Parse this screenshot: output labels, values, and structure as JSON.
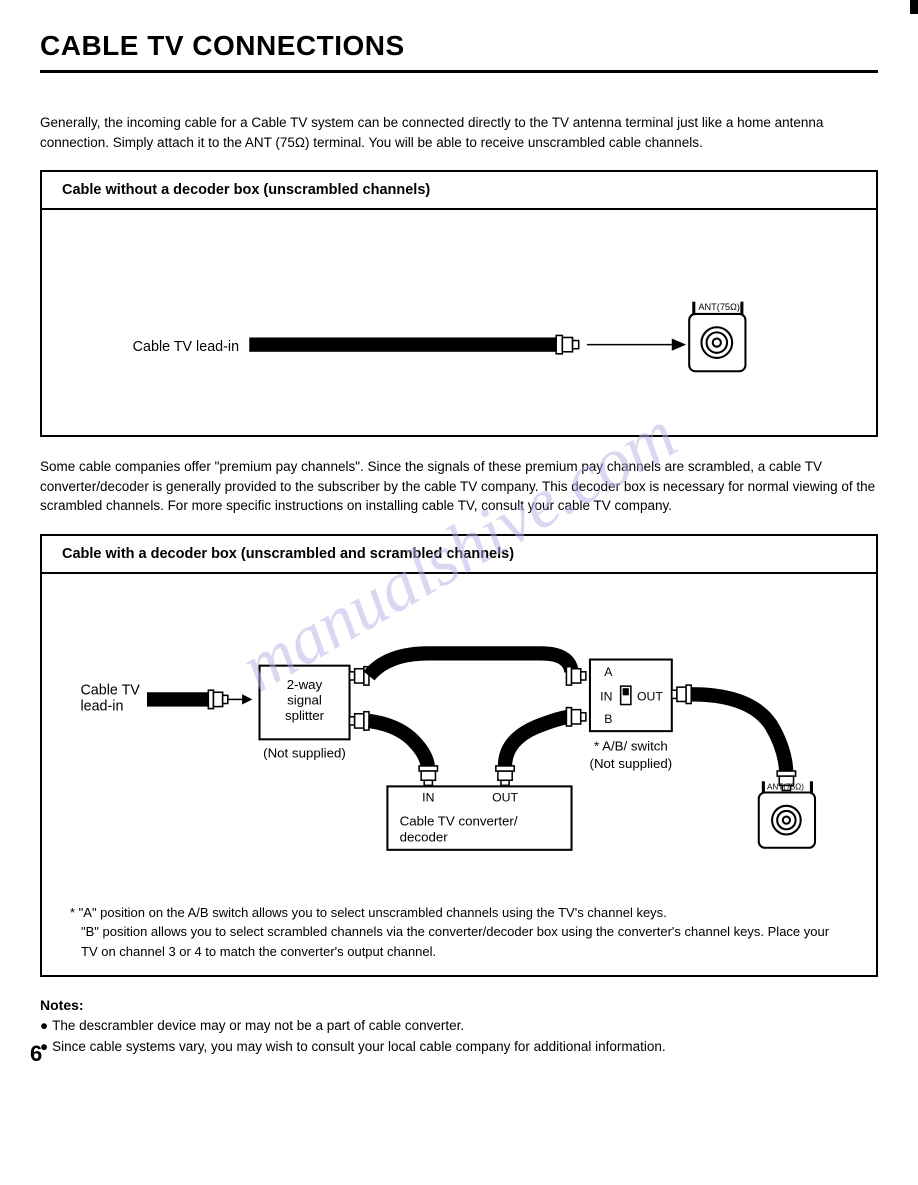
{
  "page": {
    "title": "CABLE TV CONNECTIONS",
    "intro": "Generally, the incoming cable for a Cable TV system can be connected directly to the TV antenna terminal just like a home antenna connection. Simply attach it to the ANT (75Ω) terminal. You will be able to receive unscrambled cable channels.",
    "mid": "Some cable companies offer \"premium pay channels\". Since the signals of these premium pay channels are scrambled, a cable TV converter/decoder is generally provided to the subscriber by the cable TV company. This decoder box is necessary for normal viewing of the scrambled channels. For more specific instructions on installing cable TV, consult your cable TV company.",
    "number": "6"
  },
  "diagram1": {
    "header": "Cable without a decoder box (unscrambled channels)",
    "lead_label": "Cable TV lead-in",
    "ant_label": "ANT(75Ω)"
  },
  "diagram2": {
    "header": "Cable with a decoder box (unscrambled and scrambled channels)",
    "lead_label": "Cable TV lead-in",
    "splitter_l1": "2-way",
    "splitter_l2": "signal",
    "splitter_l3": "splitter",
    "not_supplied1": "(Not supplied)",
    "ab_a": "A",
    "ab_in": "IN",
    "ab_out": "OUT",
    "ab_b": "B",
    "ab_label": "* A/B/ switch",
    "not_supplied2": "(Not supplied)",
    "conv_in": "IN",
    "conv_out": "OUT",
    "conv_label1": "Cable TV converter/",
    "conv_label2": "decoder",
    "ant_label": "ANT(75Ω)",
    "footnote1": "* \"A\" position on the A/B switch allows you to select unscrambled channels using the TV's channel keys.",
    "footnote2": "\"B\" position allows you to select scrambled channels via the converter/decoder box using the converter's channel keys. Place your TV on channel 3 or 4 to match the converter's output channel."
  },
  "notes": {
    "heading": "Notes:",
    "b1": "The descrambler device may or may not be a part of cable converter.",
    "b2": "Since cable systems vary, you may wish to consult your local cable company for additional information."
  },
  "watermark": "manualshive.com"
}
